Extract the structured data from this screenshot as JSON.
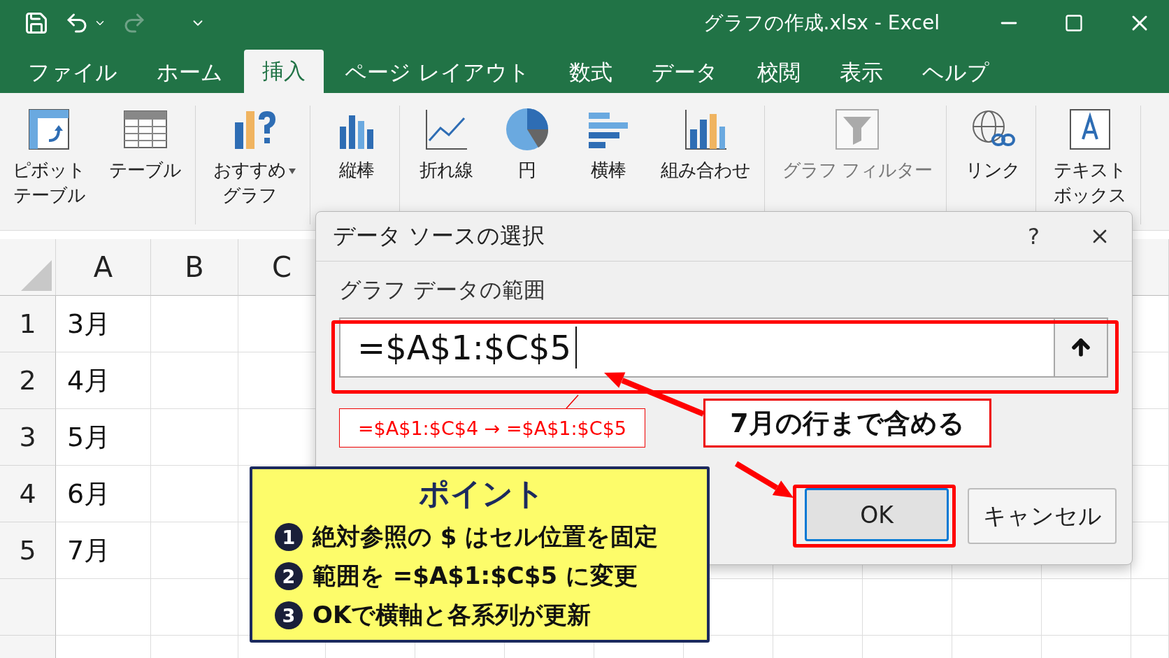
{
  "title_bar": {
    "title": "グラフの作成.xlsx - Excel"
  },
  "tabs": [
    {
      "label": "ファイル",
      "selected": false
    },
    {
      "label": "ホーム",
      "selected": false
    },
    {
      "label": "挿入",
      "selected": true
    },
    {
      "label": "ページ レイアウト",
      "selected": false
    },
    {
      "label": "数式",
      "selected": false
    },
    {
      "label": "データ",
      "selected": false
    },
    {
      "label": "校閲",
      "selected": false
    },
    {
      "label": "表示",
      "selected": false
    },
    {
      "label": "ヘルプ",
      "selected": false
    }
  ],
  "ribbon": {
    "groups": [
      [
        {
          "kind": "pivot",
          "lines": [
            "ピボット",
            "テーブル"
          ],
          "disabled": false
        },
        {
          "kind": "table",
          "lines": [
            "テーブル"
          ],
          "disabled": false
        }
      ],
      [
        {
          "kind": "recommended",
          "lines": [
            "おすすめ",
            "グラフ"
          ],
          "disabled": false
        }
      ],
      [
        {
          "kind": "column",
          "lines": [
            "縦棒"
          ],
          "disabled": false
        }
      ],
      [
        {
          "kind": "line",
          "lines": [
            "折れ線"
          ],
          "disabled": false
        },
        {
          "kind": "pie",
          "lines": [
            "円"
          ],
          "disabled": false
        },
        {
          "kind": "bar",
          "lines": [
            "横棒"
          ],
          "disabled": false
        },
        {
          "kind": "combo",
          "lines": [
            "組み合わせ"
          ],
          "disabled": false
        }
      ],
      [
        {
          "kind": "filter",
          "lines": [
            "グラフ フィルター"
          ],
          "disabled": true
        }
      ],
      [
        {
          "kind": "link",
          "lines": [
            "リンク"
          ],
          "disabled": false
        }
      ],
      [
        {
          "kind": "textbox",
          "lines": [
            "テキスト",
            "ボックス"
          ],
          "disabled": false
        }
      ]
    ]
  },
  "sheet": {
    "columns": [
      "A",
      "B",
      "C"
    ],
    "rows": [
      {
        "number": "1",
        "cells": [
          "3月"
        ]
      },
      {
        "number": "2",
        "cells": [
          "4月"
        ]
      },
      {
        "number": "3",
        "cells": [
          "5月"
        ]
      },
      {
        "number": "4",
        "cells": [
          "6月"
        ]
      },
      {
        "number": "5",
        "cells": [
          "7月"
        ]
      }
    ]
  },
  "dialog": {
    "title": "データ ソースの選択",
    "help": "?",
    "range_label": "グラフ データの範囲",
    "range_value": "=$A$1:$C$5",
    "buttons": [
      {
        "label": "OK",
        "focused": true
      },
      {
        "label": "キャンセル",
        "focused": false
      }
    ]
  },
  "annotations": {
    "change_note": "=$A$1:$C$4 → =$A$1:$C$5",
    "callout": "7月の行まで含める",
    "point_box": {
      "title": "ポイント",
      "items": [
        {
          "number": "1",
          "text": "絶対参照の $ はセル位置を固定"
        },
        {
          "number": "2",
          "text": "範囲を =$A$1:$C$5 に変更"
        },
        {
          "number": "3",
          "text": "OKで横軸と各系列が更新"
        }
      ]
    }
  }
}
